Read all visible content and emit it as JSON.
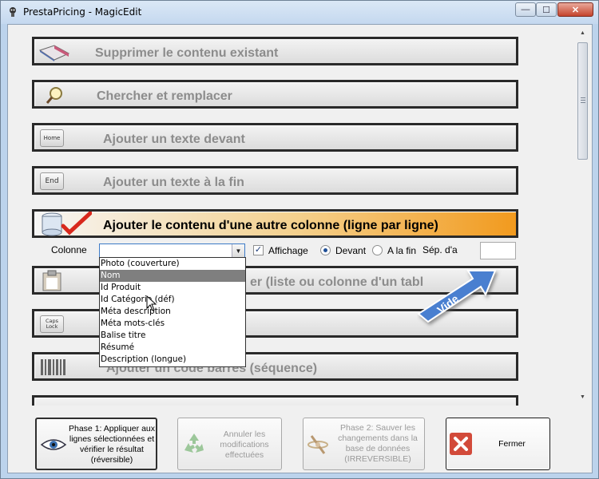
{
  "window": {
    "title": "PrestaPricing - MagicEdit",
    "controls": {
      "minimize": "—",
      "maximize": "☐",
      "close": "✕"
    }
  },
  "actions": [
    {
      "label": "Supprimer le contenu existant",
      "icon": "eraser-icon"
    },
    {
      "label": "Chercher et remplacer",
      "icon": "magnifier-icon"
    },
    {
      "label": "Ajouter un texte devant",
      "icon": "home-key-icon",
      "key": "Home"
    },
    {
      "label": "Ajouter un texte à la fin",
      "icon": "end-key-icon",
      "key": "End"
    },
    {
      "label": "Ajouter le contenu d'une autre colonne (ligne par ligne)",
      "icon": "column-check-icon"
    },
    {
      "label": "er (liste ou colonne d'un tabl",
      "icon": "clipboard-icon"
    },
    {
      "label": "",
      "icon": "caps-lock-key-icon",
      "key": "Caps Lock"
    },
    {
      "label": "Ajouter un code barres (séquence)",
      "icon": "barcode-icon"
    },
    {
      "label": "",
      "icon": "partial-icon"
    }
  ],
  "options": {
    "column_label": "Colonne",
    "column_value": "",
    "display_label": "Affichage",
    "display_checked": true,
    "front_label": "Devant",
    "end_label": "A la fin",
    "position_selected": "Devant",
    "separator_label": "Sép. d'a",
    "separator_value": ""
  },
  "dropdown": {
    "items": [
      "Photo (couverture)",
      "Nom",
      "Id Produit",
      "Id Catégorie (déf)",
      "Méta description",
      "Méta mots-clés",
      "Balise titre",
      "Résumé",
      "Description (longue)"
    ],
    "hovered": "Nom"
  },
  "callout": {
    "text": "Vide",
    "color": "#4a7fd0"
  },
  "buttons": {
    "phase1": "Phase 1: Appliquer aux lignes sélectionnées et vérifier le résultat (réversible)",
    "cancel": "Annuler les modifications effectuées",
    "phase2": "Phase 2: Sauver les changements dans la base de données (IRREVERSIBLE)",
    "close": "Fermer"
  },
  "colors": {
    "accent_orange": "#f29a1e",
    "close_red": "#c5432c"
  }
}
